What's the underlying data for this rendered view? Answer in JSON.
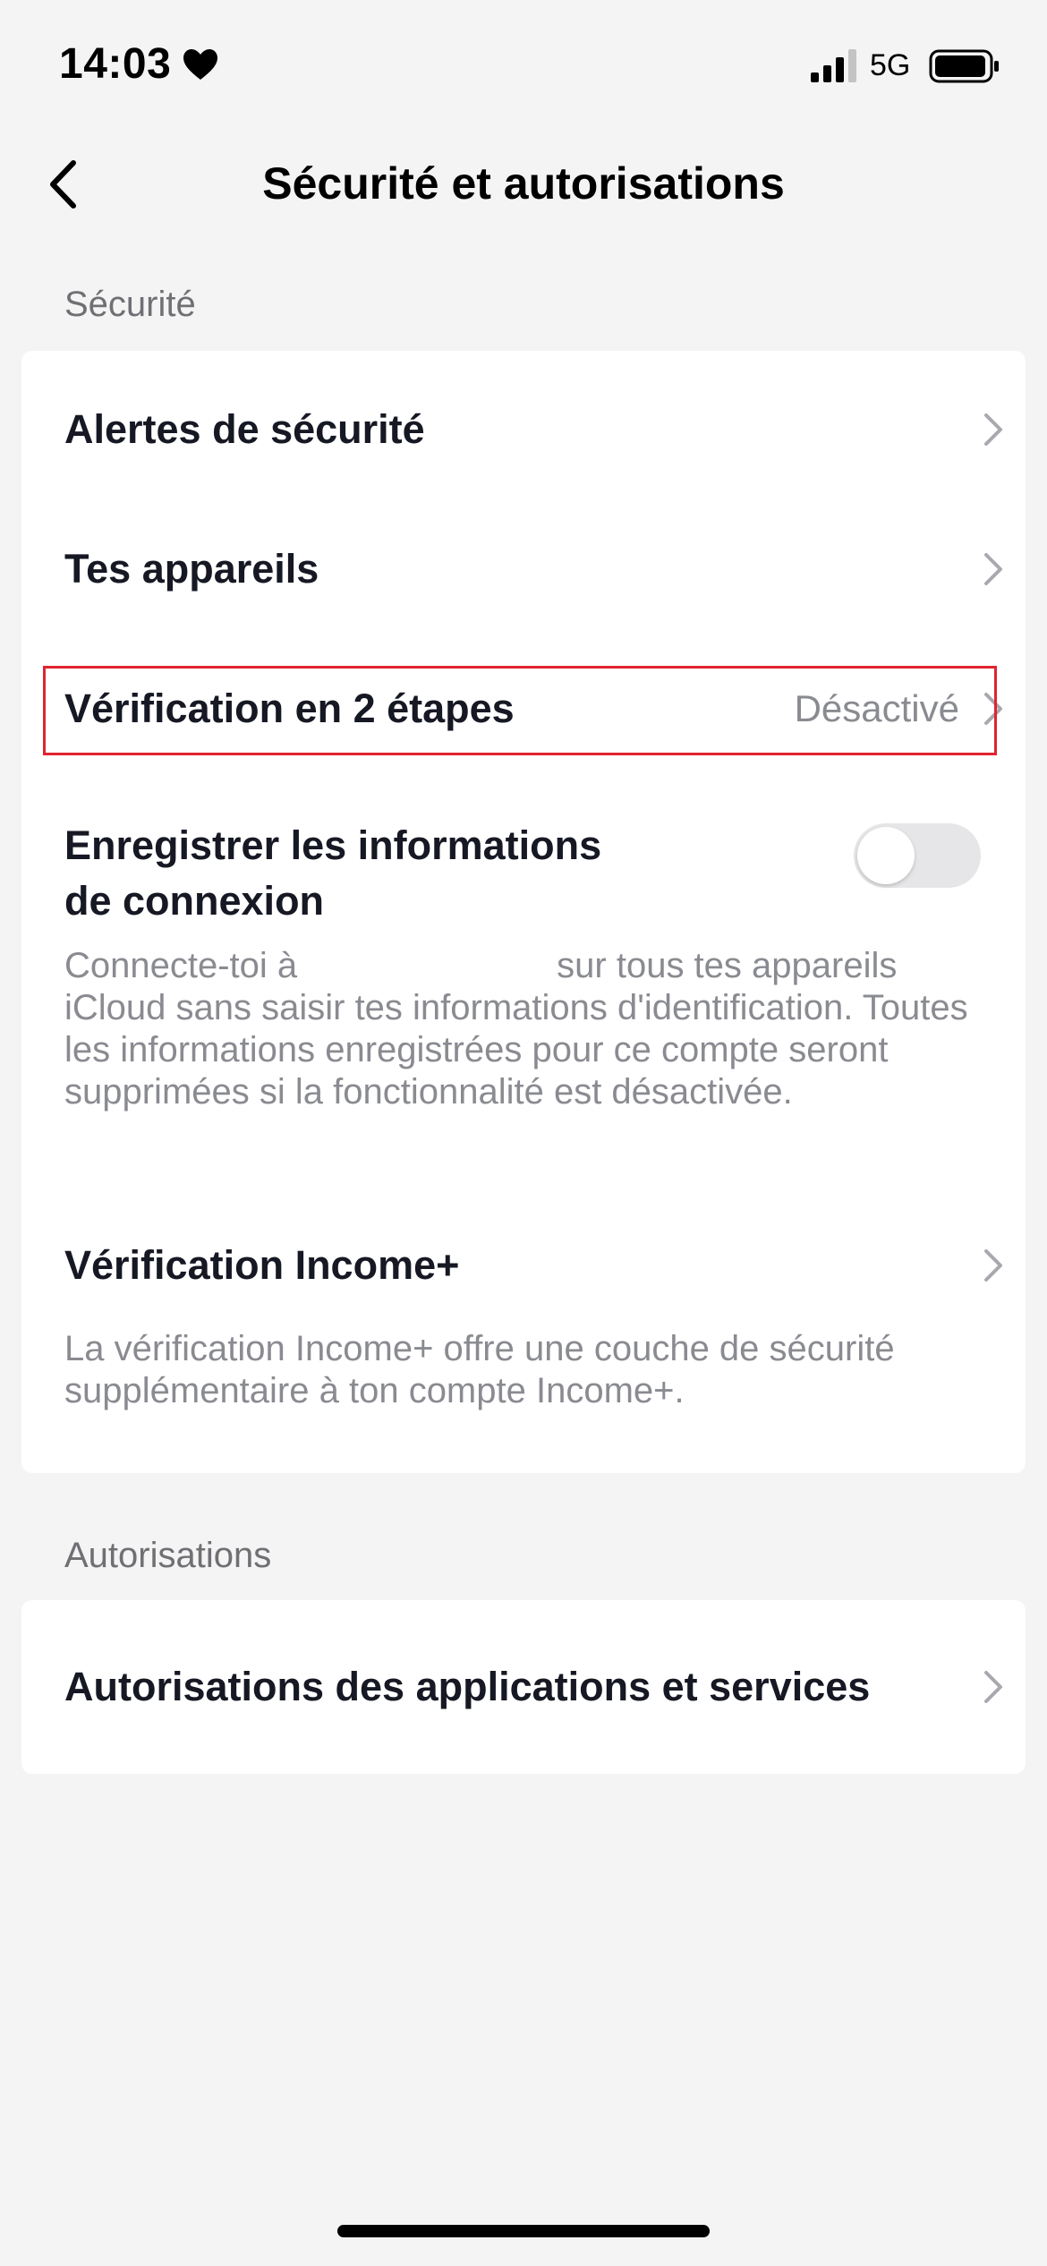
{
  "status_bar": {
    "time": "14:03",
    "heart_icon": "heart-icon",
    "signal_icon": "cellular-signal-icon",
    "network": "5G",
    "battery_icon": "battery-icon"
  },
  "nav": {
    "back_icon": "chevron-left-icon",
    "title": "Sécurité et autorisations"
  },
  "security_section": {
    "header": "Sécurité",
    "items": [
      {
        "label": "Alertes de sécurité",
        "value": "",
        "icon": "chevron-right-icon"
      },
      {
        "label": "Tes appareils",
        "value": "",
        "icon": "chevron-right-icon"
      },
      {
        "label": "Vérification en 2 étapes",
        "value": "Désactivé",
        "icon": "chevron-right-icon"
      }
    ],
    "save_login": {
      "label_line1": "Enregistrer les informations",
      "label_line2": "de connexion",
      "toggle_on": false,
      "desc_part1": "Connecte-toi à",
      "desc_part2": "sur tous tes appareils iCloud sans saisir tes informations d'identification. Toutes les informations enregistrées pour ce compte seront supprimées si la fonctionnalité est désactivée."
    },
    "income": {
      "label": "Vérification Income+",
      "desc": "La vérification Income+ offre une couche de sécurité supplémentaire à ton compte Income+.",
      "icon": "chevron-right-icon"
    }
  },
  "permissions_section": {
    "header": "Autorisations",
    "items": [
      {
        "label": "Autorisations des applications et services",
        "icon": "chevron-right-icon"
      }
    ]
  },
  "colors": {
    "background": "#f4f4f4",
    "card": "#ffffff",
    "highlight": "#e0242f",
    "secondary_text": "#8a8b91"
  }
}
